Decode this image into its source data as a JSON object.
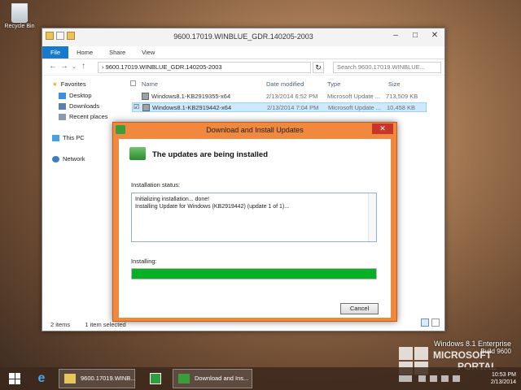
{
  "desktop": {
    "recycle_bin_label": "Recycle Bin"
  },
  "explorer": {
    "title": "9600.17019.WINBLUE_GDR.140205-2003",
    "window_buttons": {
      "minimize": "–",
      "maximize": "□",
      "close": "✕"
    },
    "ribbon_tabs": [
      "File",
      "Home",
      "Share",
      "View"
    ],
    "address": "› 9600.17019.WINBLUE_GDR.140205-2003",
    "search_placeholder": "Search 9600.17019.WINBLUE...",
    "nav": {
      "favorites": "Favorites",
      "desktop": "Desktop",
      "downloads": "Downloads",
      "recent": "Recent places",
      "this_pc": "This PC",
      "network": "Network"
    },
    "columns": {
      "name": "Name",
      "date": "Date modified",
      "type": "Type",
      "size": "Size"
    },
    "files": [
      {
        "name": "Windows8.1-KB2919355-x64",
        "date": "2/13/2014 6:52 PM",
        "type": "Microsoft Update ...",
        "size": "713,509 KB",
        "selected": false
      },
      {
        "name": "Windows8.1-KB2919442-x64",
        "date": "2/13/2014 7:04 PM",
        "type": "Microsoft Update ...",
        "size": "10,458 KB",
        "selected": true
      }
    ],
    "status_items": "2 items",
    "status_selected": "1 item selected"
  },
  "dialog": {
    "title": "Download and Install Updates",
    "close": "✕",
    "heading": "The updates are being installed",
    "status_label": "Installation status:",
    "log_lines": [
      "Initializing installation... done!",
      "Installing Update for Windows (KB2919442) (update 1 of 1)..."
    ],
    "installing_label": "Installing:",
    "progress": 1.0,
    "cancel_label": "Cancel"
  },
  "watermark": {
    "edition": "Windows 8.1 Enterprise",
    "build": "Build 9600",
    "portal_line1": "MICROSOFT",
    "portal_line2": "PORTAL"
  },
  "taskbar": {
    "explorer_label": "9600.17019.WINB...",
    "dialog_label": "Download and Ins...",
    "time": "10:53 PM",
    "date": "2/13/2014"
  },
  "colors": {
    "accent": "#1979ca",
    "dialog_frame": "#f0893e",
    "progress": "#06b025"
  }
}
